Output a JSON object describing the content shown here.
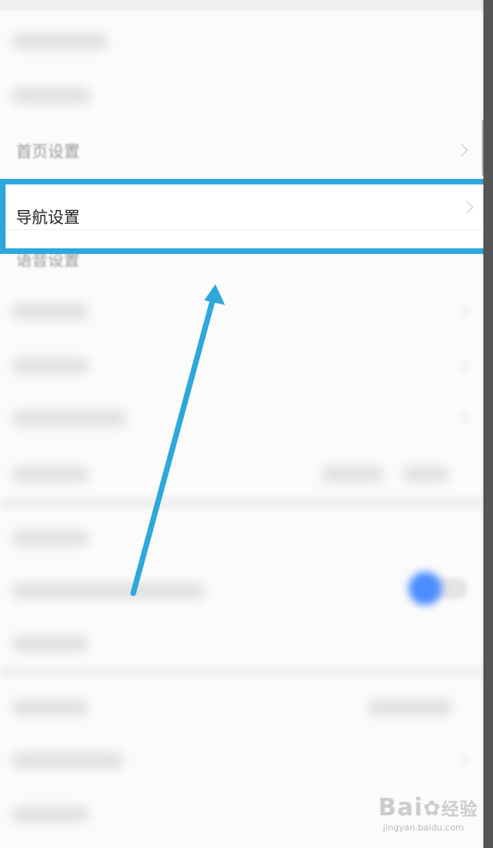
{
  "rows": {
    "blur_1": "",
    "blur_2": "",
    "homepage_settings": "首页设置",
    "navigation_settings": "导航设置",
    "voice_settings": "语音设置"
  },
  "watermark": {
    "brand": "Bai",
    "brand_suffix": "经验",
    "domain": "jingyan.baidu.com"
  },
  "colors": {
    "highlight": "#2ea8dc",
    "arrow": "#2ea8dc",
    "toggle": "#4c8dff"
  }
}
